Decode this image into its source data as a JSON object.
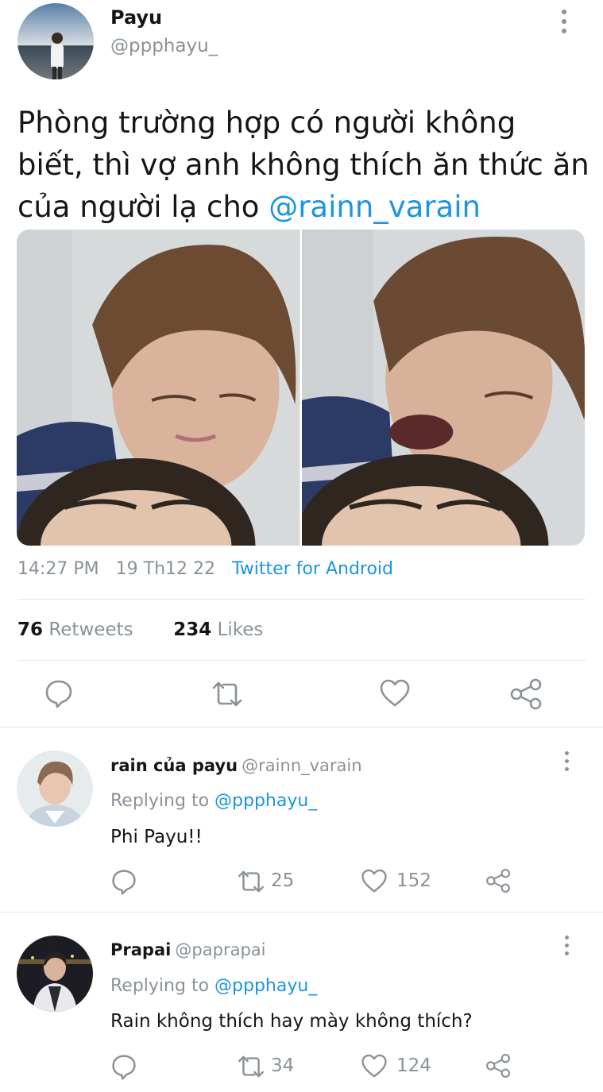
{
  "tweet": {
    "author_name": "Payu",
    "author_handle": "@ppphayu_",
    "text_prefix": "Phòng trường hợp có người không biết, thì vợ anh không thích ăn thức ăn của người lạ cho ",
    "text_mention": "@rainn_varain",
    "time": "14:27 PM",
    "date": "19 Th12 22",
    "source": "Twitter for Android",
    "retweets_count": "76",
    "retweets_label": "Retweets",
    "likes_count": "234",
    "likes_label": "Likes"
  },
  "icons": {
    "reply": "reply-icon",
    "retweet": "retweet-icon",
    "like": "heart-icon",
    "share": "share-icon",
    "more": "more-vertical-icon"
  },
  "replies": [
    {
      "name": "rain của payu",
      "handle": "@rainn_varain",
      "replying_label": "Replying to",
      "replying_to": "@ppphayu_",
      "text": "Phi Payu!!",
      "retweets": "25",
      "likes": "152"
    },
    {
      "name": "Prapai",
      "handle": "@paprapai",
      "replying_label": "Replying to",
      "replying_to": "@ppphayu_",
      "text": "Rain không thích hay mày không thích?",
      "retweets": "34",
      "likes": "124"
    }
  ],
  "colors": {
    "accent": "#1b95e0",
    "muted": "#8a9299",
    "text": "#14171a",
    "divider": "#e1e8ed"
  }
}
